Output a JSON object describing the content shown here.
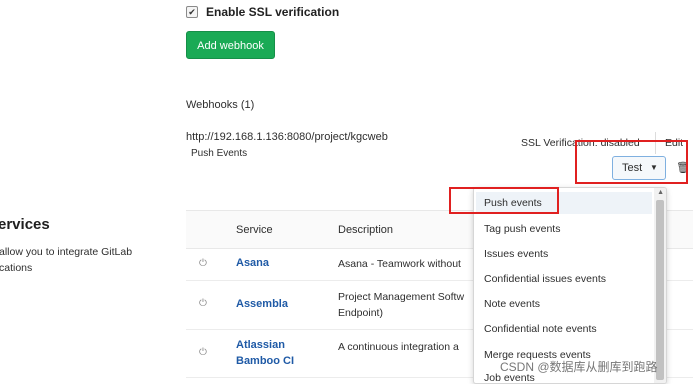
{
  "ssl": {
    "checkbox_mark": "✔",
    "label": "Enable SSL verification"
  },
  "add_webhook_label": "Add webhook",
  "webhooks": {
    "title": "Webhooks (1)",
    "url": "http://192.168.1.136:8080/project/kgcweb",
    "events": "Push Events",
    "ssl_status": "SSL Verification: disabled",
    "edit_label": "Edit",
    "test_label": "Test",
    "test_caret": "▼",
    "trash_glyph": "🗑"
  },
  "services": {
    "title": "ervices",
    "desc_line1": "allow you to integrate GitLab",
    "desc_line2": "cations"
  },
  "table": {
    "headers": {
      "service": "Service",
      "description": "Description"
    },
    "rows": [
      {
        "icon": "⏻",
        "name": "Asana",
        "desc": "Asana - Teamwork without"
      },
      {
        "icon": "⏻",
        "name": "Assembla",
        "desc_line1": "Project Management Softw",
        "desc_line2": "Endpoint)"
      },
      {
        "icon": "⏻",
        "name_line1": "Atlassian",
        "name_line2": "Bamboo CI",
        "desc": "A continuous integration a"
      }
    ]
  },
  "dropdown": {
    "items": [
      "Push events",
      "Tag push events",
      "Issues events",
      "Confidential issues events",
      "Note events",
      "Confidential note events",
      "Merge requests events",
      "Job events"
    ],
    "scroll_up_glyph": "▲"
  },
  "watermark": "CSDN @数据库从删库到跑路",
  "colors": {
    "accent_green": "#1aaa55",
    "link_blue": "#1f5aa6",
    "annotation_red": "#e02020"
  }
}
